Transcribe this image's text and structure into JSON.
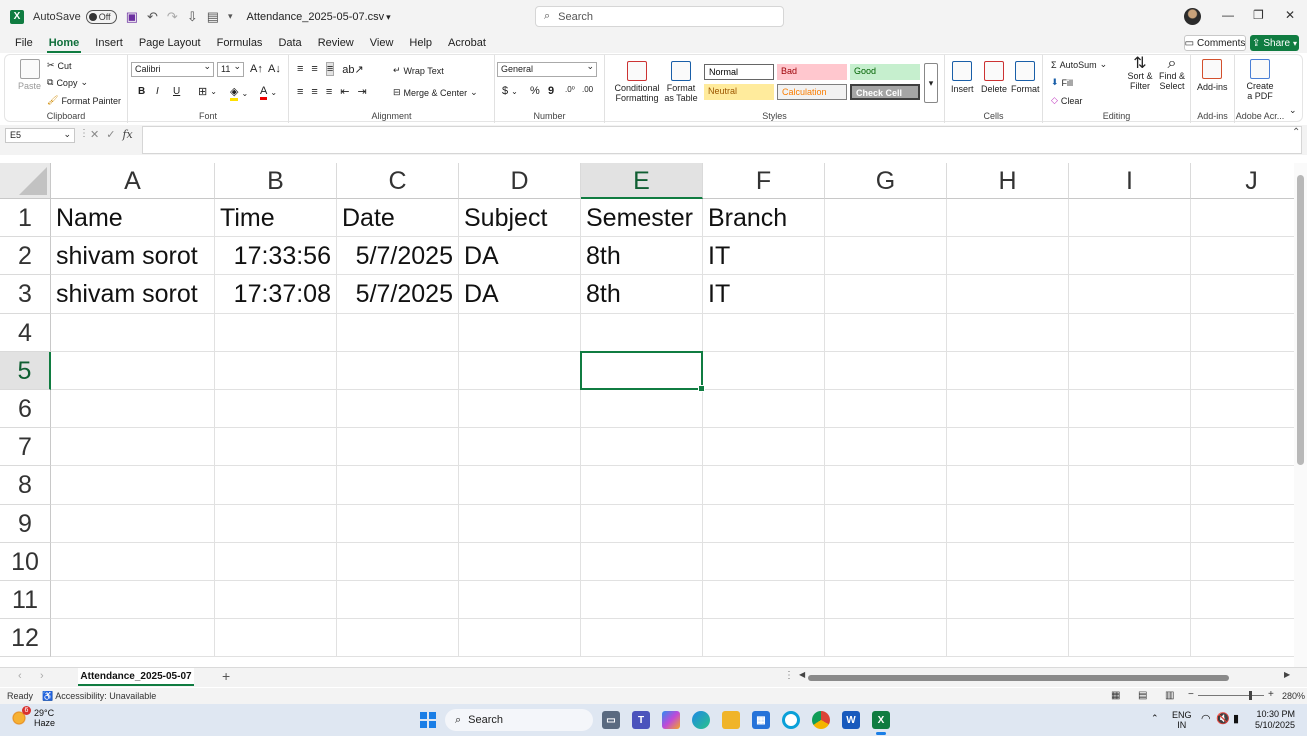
{
  "titlebar": {
    "logo": "X",
    "autosave_label": "AutoSave",
    "autosave_state": "Off",
    "doc_title": "Attendance_2025-05-07.csv",
    "search_placeholder": "Search"
  },
  "menu_tabs": [
    "File",
    "Home",
    "Insert",
    "Page Layout",
    "Formulas",
    "Data",
    "Review",
    "View",
    "Help",
    "Acrobat"
  ],
  "active_tab": "Home",
  "header_buttons": {
    "comments": "Comments",
    "share": "Share"
  },
  "ribbon": {
    "clipboard": {
      "label": "Clipboard",
      "paste": "Paste",
      "cut": "Cut",
      "copy": "Copy",
      "format_painter": "Format Painter"
    },
    "font": {
      "label": "Font",
      "name": "Calibri",
      "size": "11",
      "bold": "B",
      "italic": "I",
      "underline": "U",
      "grow": "A^",
      "shrink": "Aˇ"
    },
    "alignment": {
      "label": "Alignment",
      "wrap_text": "Wrap Text",
      "merge_center": "Merge & Center"
    },
    "number": {
      "label": "Number",
      "format": "General",
      "currency": "$",
      "percent": "%",
      "comma": "9"
    },
    "styles": {
      "label": "Styles",
      "conditional": "Conditional Formatting",
      "format_table": "Format as Table",
      "normal": "Normal",
      "bad": "Bad",
      "good": "Good",
      "neutral": "Neutral",
      "calculation": "Calculation",
      "check_cell": "Check Cell"
    },
    "cells": {
      "label": "Cells",
      "insert": "Insert",
      "delete": "Delete",
      "format": "Format"
    },
    "editing": {
      "label": "Editing",
      "autosum": "AutoSum",
      "fill": "Fill",
      "clear": "Clear",
      "sort_filter": "Sort & Filter",
      "find_select": "Find & Select"
    },
    "addins": {
      "label": "Add-ins",
      "button": "Add-ins"
    },
    "adobe": {
      "label": "Adobe Acr...",
      "button": "Create a PDF"
    }
  },
  "formula_bar": {
    "name_box": "E5",
    "fx": "fx",
    "value": ""
  },
  "columns": [
    "A",
    "B",
    "C",
    "D",
    "E",
    "F",
    "G",
    "H",
    "I",
    "J"
  ],
  "rows": [
    "1",
    "2",
    "3",
    "4",
    "5",
    "6",
    "7",
    "8",
    "9",
    "10",
    "11",
    "12"
  ],
  "selected_cell": "E5",
  "cells": {
    "A1": "Name",
    "B1": "Time",
    "C1": "Date",
    "D1": "Subject",
    "E1": "Semester",
    "F1": "Branch",
    "A2": "shivam sorot",
    "B2": "17:33:56",
    "C2": "5/7/2025",
    "D2": "DA",
    "E2": "8th",
    "F2": "IT",
    "A3": "shivam sorot",
    "B3": "17:37:08",
    "C3": "5/7/2025",
    "D3": "DA",
    "E3": "8th",
    "F3": "IT"
  },
  "sheet_tabs": [
    "Attendance_2025-05-07"
  ],
  "status": {
    "ready": "Ready",
    "accessibility": "Accessibility: Unavailable",
    "zoom": "280%"
  },
  "taskbar": {
    "weather_temp": "29°C",
    "weather_desc": "Haze",
    "weather_badge": "6",
    "search": "Search",
    "lang_top": "ENG",
    "lang_bottom": "IN",
    "time": "10:30 PM",
    "date": "5/10/2025"
  },
  "colors": {
    "accent": "#107c41",
    "brand_excel": "#107c41",
    "share": "#107c41"
  }
}
